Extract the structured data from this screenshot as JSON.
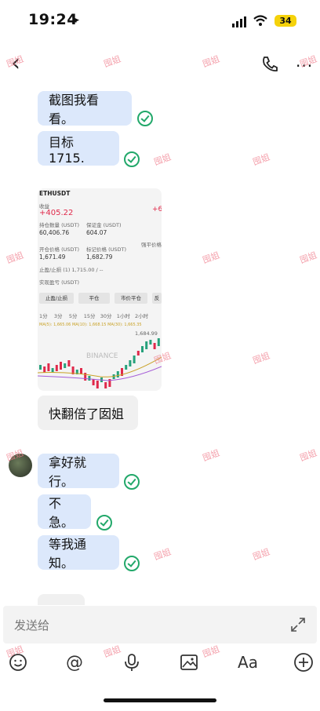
{
  "status": {
    "time": "19:24",
    "battery": "34"
  },
  "messages": {
    "m1": "截图我看看。",
    "m2": "目标1715.",
    "m3": "快翻倍了囡姐",
    "m4": "拿好就行。",
    "m5": "不急。",
    "m6": "等我通知。"
  },
  "screenshot": {
    "symbol": "ETHUSDT",
    "pnl_label": "收益",
    "pnl": "+405.22",
    "pnl_right": "+6",
    "size_label": "持仓数量 (USDT)",
    "size": "60,406.76",
    "margin_label": "保证金 (USDT)",
    "margin": "604.07",
    "entry_label": "开仓价格 (USDT)",
    "entry": "1,671.49",
    "mark_label": "标记价格 (USDT)",
    "mark": "1,682.79",
    "liq_label": "强平价格",
    "tpsl": "止盈/止损 (1) 1,715.00 / --",
    "realized_label": "实现盈亏 (USDT)",
    "btn_tpsl": "止盈/止损",
    "btn_close": "平仓",
    "btn_market_close": "市价平仓",
    "btn_more": "反",
    "intervals": [
      "1分",
      "3分",
      "5分",
      "15分",
      "30分",
      "1小时",
      "2小时"
    ],
    "ma_line": "MA(5): 1,665.06  MA(10): 1,668.15  MA(30): 1,665.35",
    "price_high": "1,684.99",
    "watermark_logo": "BINANCE"
  },
  "input": {
    "placeholder": "发送给"
  },
  "toolbar": {
    "font_label": "Aa"
  },
  "watermark": "囤姐",
  "colors": {
    "bubble": "#dce8fb",
    "check": "#22a86a",
    "up": "#26a17b",
    "down": "#e0294a"
  }
}
